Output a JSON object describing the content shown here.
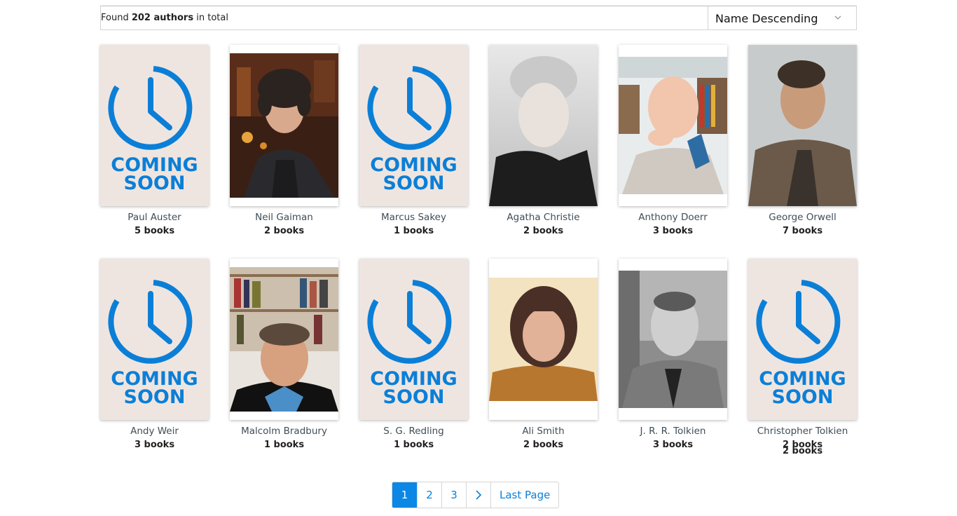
{
  "header": {
    "found_prefix": "Found",
    "found_count": "202 authors",
    "found_suffix": "in total",
    "sort_label": "Name Descending"
  },
  "placeholder": {
    "line1": "COMING",
    "line2": "SOON",
    "color": "#0b7fd7"
  },
  "authors": [
    {
      "name": "Paul Auster",
      "books": "5 books",
      "cover": "coming-soon"
    },
    {
      "name": "Neil Gaiman",
      "books": "2 books",
      "cover": "photo"
    },
    {
      "name": "Marcus Sakey",
      "books": "1 books",
      "cover": "coming-soon"
    },
    {
      "name": "Agatha Christie",
      "books": "2 books",
      "cover": "photo"
    },
    {
      "name": "Anthony Doerr",
      "books": "3 books",
      "cover": "photo"
    },
    {
      "name": "George Orwell",
      "books": "7 books",
      "cover": "photo"
    },
    {
      "name": "Andy Weir",
      "books": "3 books",
      "cover": "coming-soon"
    },
    {
      "name": "Malcolm Bradbury",
      "books": "1 books",
      "cover": "photo"
    },
    {
      "name": "S. G. Redling",
      "books": "1 books",
      "cover": "coming-soon"
    },
    {
      "name": "Ali Smith",
      "books": "2 books",
      "cover": "photo"
    },
    {
      "name": "J. R. R. Tolkien",
      "books": "3 books",
      "cover": "photo"
    },
    {
      "name": "Christopher Tolkien",
      "books": "2 books",
      "books_overlap": "2 books",
      "cover": "coming-soon"
    }
  ],
  "pagination": {
    "pages": [
      "1",
      "2",
      "3"
    ],
    "current": "1",
    "next_icon": "chevron-right-icon",
    "last_label": "Last Page"
  },
  "colors": {
    "accent": "#0b87e5",
    "placeholder_bg": "#efe5e0"
  }
}
